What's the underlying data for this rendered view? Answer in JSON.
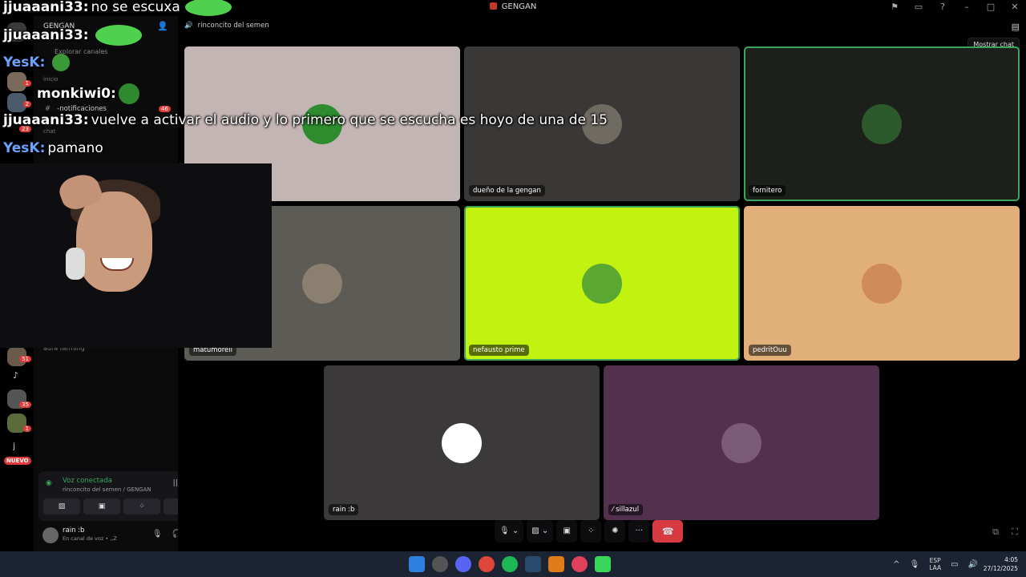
{
  "window": {
    "title": "GENGAN"
  },
  "rail": {
    "badges": [
      "1",
      "2",
      "23",
      "51",
      "35",
      "1"
    ],
    "nuevo": "NUEVO",
    "letter": "j"
  },
  "sidebar": {
    "server_name": "GENGAN",
    "explore": "Explorar canales",
    "inicio": "inicio",
    "notif_channel": "-notificaciones",
    "notif_badge": "46",
    "chat_category": "chat",
    "aura_channel": "aura farming"
  },
  "voice": {
    "status": "Voz conectada",
    "location": "rinconcito del semen / GENGAN"
  },
  "user": {
    "name": "rain :b",
    "status": "En canal de voz • ,,Z"
  },
  "channel": {
    "name": "rinconcito del semen",
    "tooltip": "Mostrar chat"
  },
  "participants": [
    {
      "name": "",
      "bg": "#c4b5b5",
      "avatar": "#2e8b2e"
    },
    {
      "name": "dueño de la gengan",
      "bg": "#3a3836",
      "avatar": "#6f6a62"
    },
    {
      "name": "fornitero",
      "bg": "#1c1f1a",
      "avatar": "#2d5a2d"
    },
    {
      "name": "matumorell",
      "bg": "#5c5b55",
      "avatar": "#8b7f70"
    },
    {
      "name": "nefausto prime",
      "bg": "#c2f20f",
      "avatar": "#5aa832"
    },
    {
      "name": "pedritOuu",
      "bg": "#e1b07a",
      "avatar": "#d08b5a"
    },
    {
      "name": "rain :b",
      "bg": "#3b393a",
      "avatar": "#ffffff"
    },
    {
      "name": "sillazul",
      "bg": "#54304f",
      "avatar": "#7b5a7a"
    }
  ],
  "overlay_chat": [
    {
      "user": "jjuaaani33:",
      "msg": "no se escuxa",
      "color": "#ffffff"
    },
    {
      "user": "jjuaaani33:",
      "msg": "",
      "color": "#ffffff"
    },
    {
      "user": "YesK:",
      "msg": "",
      "color": "#6aa3ff"
    },
    {
      "user": "monkiwi0:",
      "msg": "",
      "color": "#ffffff"
    },
    {
      "user": "jjuaaani33:",
      "msg": "vuelve a activar el audio y lo primero que se escucha es hoyo de una de 15",
      "color": "#ffffff"
    },
    {
      "user": "YesK:",
      "msg": "pamano",
      "color": "#6aa3ff"
    }
  ],
  "taskbar": {
    "lang1": "ESP",
    "lang2": "LAA",
    "time": "4:05",
    "date": "27/12/2025"
  }
}
